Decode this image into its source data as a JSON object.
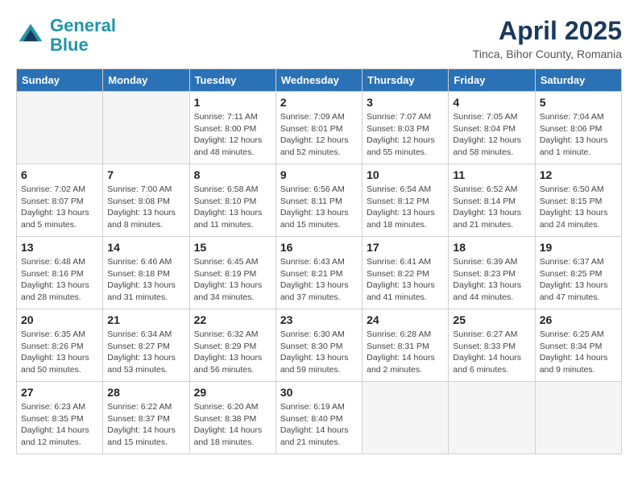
{
  "header": {
    "logo_line1": "General",
    "logo_line2": "Blue",
    "month_year": "April 2025",
    "location": "Tinca, Bihor County, Romania"
  },
  "days_of_week": [
    "Sunday",
    "Monday",
    "Tuesday",
    "Wednesday",
    "Thursday",
    "Friday",
    "Saturday"
  ],
  "weeks": [
    [
      {
        "day": "",
        "empty": true
      },
      {
        "day": "",
        "empty": true
      },
      {
        "day": "1",
        "sunrise": "Sunrise: 7:11 AM",
        "sunset": "Sunset: 8:00 PM",
        "daylight": "Daylight: 12 hours and 48 minutes."
      },
      {
        "day": "2",
        "sunrise": "Sunrise: 7:09 AM",
        "sunset": "Sunset: 8:01 PM",
        "daylight": "Daylight: 12 hours and 52 minutes."
      },
      {
        "day": "3",
        "sunrise": "Sunrise: 7:07 AM",
        "sunset": "Sunset: 8:03 PM",
        "daylight": "Daylight: 12 hours and 55 minutes."
      },
      {
        "day": "4",
        "sunrise": "Sunrise: 7:05 AM",
        "sunset": "Sunset: 8:04 PM",
        "daylight": "Daylight: 12 hours and 58 minutes."
      },
      {
        "day": "5",
        "sunrise": "Sunrise: 7:04 AM",
        "sunset": "Sunset: 8:06 PM",
        "daylight": "Daylight: 13 hours and 1 minute."
      }
    ],
    [
      {
        "day": "6",
        "sunrise": "Sunrise: 7:02 AM",
        "sunset": "Sunset: 8:07 PM",
        "daylight": "Daylight: 13 hours and 5 minutes."
      },
      {
        "day": "7",
        "sunrise": "Sunrise: 7:00 AM",
        "sunset": "Sunset: 8:08 PM",
        "daylight": "Daylight: 13 hours and 8 minutes."
      },
      {
        "day": "8",
        "sunrise": "Sunrise: 6:58 AM",
        "sunset": "Sunset: 8:10 PM",
        "daylight": "Daylight: 13 hours and 11 minutes."
      },
      {
        "day": "9",
        "sunrise": "Sunrise: 6:56 AM",
        "sunset": "Sunset: 8:11 PM",
        "daylight": "Daylight: 13 hours and 15 minutes."
      },
      {
        "day": "10",
        "sunrise": "Sunrise: 6:54 AM",
        "sunset": "Sunset: 8:12 PM",
        "daylight": "Daylight: 13 hours and 18 minutes."
      },
      {
        "day": "11",
        "sunrise": "Sunrise: 6:52 AM",
        "sunset": "Sunset: 8:14 PM",
        "daylight": "Daylight: 13 hours and 21 minutes."
      },
      {
        "day": "12",
        "sunrise": "Sunrise: 6:50 AM",
        "sunset": "Sunset: 8:15 PM",
        "daylight": "Daylight: 13 hours and 24 minutes."
      }
    ],
    [
      {
        "day": "13",
        "sunrise": "Sunrise: 6:48 AM",
        "sunset": "Sunset: 8:16 PM",
        "daylight": "Daylight: 13 hours and 28 minutes."
      },
      {
        "day": "14",
        "sunrise": "Sunrise: 6:46 AM",
        "sunset": "Sunset: 8:18 PM",
        "daylight": "Daylight: 13 hours and 31 minutes."
      },
      {
        "day": "15",
        "sunrise": "Sunrise: 6:45 AM",
        "sunset": "Sunset: 8:19 PM",
        "daylight": "Daylight: 13 hours and 34 minutes."
      },
      {
        "day": "16",
        "sunrise": "Sunrise: 6:43 AM",
        "sunset": "Sunset: 8:21 PM",
        "daylight": "Daylight: 13 hours and 37 minutes."
      },
      {
        "day": "17",
        "sunrise": "Sunrise: 6:41 AM",
        "sunset": "Sunset: 8:22 PM",
        "daylight": "Daylight: 13 hours and 41 minutes."
      },
      {
        "day": "18",
        "sunrise": "Sunrise: 6:39 AM",
        "sunset": "Sunset: 8:23 PM",
        "daylight": "Daylight: 13 hours and 44 minutes."
      },
      {
        "day": "19",
        "sunrise": "Sunrise: 6:37 AM",
        "sunset": "Sunset: 8:25 PM",
        "daylight": "Daylight: 13 hours and 47 minutes."
      }
    ],
    [
      {
        "day": "20",
        "sunrise": "Sunrise: 6:35 AM",
        "sunset": "Sunset: 8:26 PM",
        "daylight": "Daylight: 13 hours and 50 minutes."
      },
      {
        "day": "21",
        "sunrise": "Sunrise: 6:34 AM",
        "sunset": "Sunset: 8:27 PM",
        "daylight": "Daylight: 13 hours and 53 minutes."
      },
      {
        "day": "22",
        "sunrise": "Sunrise: 6:32 AM",
        "sunset": "Sunset: 8:29 PM",
        "daylight": "Daylight: 13 hours and 56 minutes."
      },
      {
        "day": "23",
        "sunrise": "Sunrise: 6:30 AM",
        "sunset": "Sunset: 8:30 PM",
        "daylight": "Daylight: 13 hours and 59 minutes."
      },
      {
        "day": "24",
        "sunrise": "Sunrise: 6:28 AM",
        "sunset": "Sunset: 8:31 PM",
        "daylight": "Daylight: 14 hours and 2 minutes."
      },
      {
        "day": "25",
        "sunrise": "Sunrise: 6:27 AM",
        "sunset": "Sunset: 8:33 PM",
        "daylight": "Daylight: 14 hours and 6 minutes."
      },
      {
        "day": "26",
        "sunrise": "Sunrise: 6:25 AM",
        "sunset": "Sunset: 8:34 PM",
        "daylight": "Daylight: 14 hours and 9 minutes."
      }
    ],
    [
      {
        "day": "27",
        "sunrise": "Sunrise: 6:23 AM",
        "sunset": "Sunset: 8:35 PM",
        "daylight": "Daylight: 14 hours and 12 minutes."
      },
      {
        "day": "28",
        "sunrise": "Sunrise: 6:22 AM",
        "sunset": "Sunset: 8:37 PM",
        "daylight": "Daylight: 14 hours and 15 minutes."
      },
      {
        "day": "29",
        "sunrise": "Sunrise: 6:20 AM",
        "sunset": "Sunset: 8:38 PM",
        "daylight": "Daylight: 14 hours and 18 minutes."
      },
      {
        "day": "30",
        "sunrise": "Sunrise: 6:19 AM",
        "sunset": "Sunset: 8:40 PM",
        "daylight": "Daylight: 14 hours and 21 minutes."
      },
      {
        "day": "",
        "empty": true
      },
      {
        "day": "",
        "empty": true
      },
      {
        "day": "",
        "empty": true
      }
    ]
  ]
}
